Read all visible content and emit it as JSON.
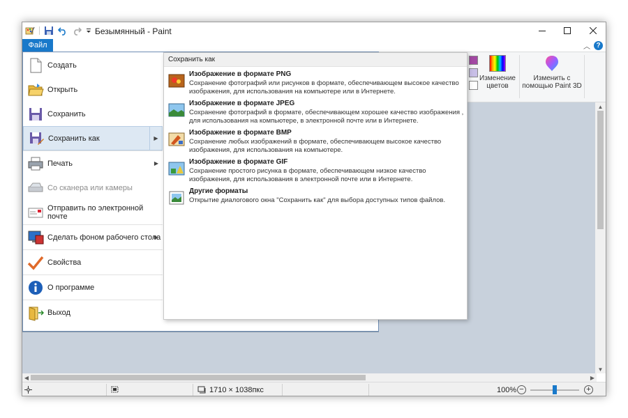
{
  "window": {
    "title": "Безымянный - Paint"
  },
  "ribbon": {
    "file_tab": "Файл",
    "edit_colors_label": "Изменение цветов",
    "paint3d_label": "Изменить с помощью Paint 3D",
    "swatch_colors": [
      "#a349a4",
      "#c8bfe7",
      "#ffffff"
    ]
  },
  "file_menu": {
    "items": [
      {
        "label": "Создать",
        "icon": "new-file-icon"
      },
      {
        "label": "Открыть",
        "icon": "open-folder-icon"
      },
      {
        "label": "Сохранить",
        "icon": "save-disk-icon"
      },
      {
        "label": "Сохранить как",
        "icon": "save-as-icon"
      },
      {
        "label": "Печать",
        "icon": "printer-icon"
      },
      {
        "label": "Со сканера или камеры",
        "icon": "scanner-icon"
      },
      {
        "label": "Отправить по электронной почте",
        "icon": "email-icon"
      },
      {
        "label": "Сделать фоном рабочего стола",
        "icon": "desktop-background-icon"
      },
      {
        "label": "Свойства",
        "icon": "checkmark-icon"
      },
      {
        "label": "О программе",
        "icon": "info-icon"
      },
      {
        "label": "Выход",
        "icon": "exit-icon"
      }
    ]
  },
  "save_as_submenu": {
    "header": "Сохранить как",
    "items": [
      {
        "title": "Изображение в формате PNG",
        "description": "Сохранение фотографий или рисунков в формате, обеспечивающем высокое качество изображения, для использования на компьютере или в Интернете.",
        "icon": "png-image-icon"
      },
      {
        "title": "Изображение в формате JPEG",
        "description": "Сохранение фотографий в формате, обеспечивающем хорошее качество изображения , для использования на компьютере, в электронной почте или в Интернете.",
        "icon": "jpeg-image-icon"
      },
      {
        "title": "Изображение в формате BMP",
        "description": "Сохранение любых изображений в формате, обеспечивающем высокое качество изображения, для использования на компьютере.",
        "icon": "bmp-image-icon"
      },
      {
        "title": "Изображение в формате GIF",
        "description": "Сохранение простого рисунка в формате, обеспечивающем низкое качество изображения, для использования в электронной почте или в Интернете.",
        "icon": "gif-image-icon"
      },
      {
        "title": "Другие форматы",
        "description": "Открытие диалогового окна \"Сохранить как\" для выбора доступных типов файлов.",
        "icon": "other-formats-icon"
      }
    ]
  },
  "statusbar": {
    "dimensions": "1710 × 1038пкс",
    "zoom": "100%",
    "zoom_level_fraction": 0.5
  }
}
